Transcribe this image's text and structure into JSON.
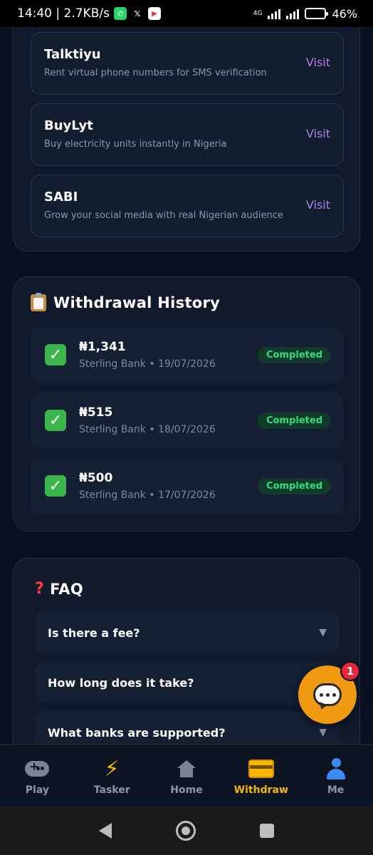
{
  "status_bar": {
    "time_speed": "14:40 | 2.7KB/s",
    "network": "4G",
    "battery": "46%",
    "battery_level": 0.46
  },
  "partners": [
    {
      "name": "Talktiyu",
      "desc": "Rent virtual phone numbers for SMS verification",
      "action": "Visit"
    },
    {
      "name": "BuyLyt",
      "desc": "Buy electricity units instantly in Nigeria",
      "action": "Visit"
    },
    {
      "name": "SABI",
      "desc": "Grow your social media with real Nigerian audience",
      "action": "Visit"
    }
  ],
  "history": {
    "title": "Withdrawal History",
    "items": [
      {
        "amount": "₦1,341",
        "meta": "Sterling Bank • 19/07/2026",
        "status": "Completed"
      },
      {
        "amount": "₦515",
        "meta": "Sterling Bank • 18/07/2026",
        "status": "Completed"
      },
      {
        "amount": "₦500",
        "meta": "Sterling Bank • 17/07/2026",
        "status": "Completed"
      }
    ]
  },
  "faq": {
    "title": "FAQ",
    "items": [
      {
        "q": "Is there a fee?"
      },
      {
        "q": "How long does it take?"
      },
      {
        "q": "What banks are supported?"
      }
    ]
  },
  "chat": {
    "badge": "1"
  },
  "nav": {
    "items": [
      {
        "label": "Play",
        "icon": "gamepad-icon"
      },
      {
        "label": "Tasker",
        "icon": "bolt-icon"
      },
      {
        "label": "Home",
        "icon": "home-icon"
      },
      {
        "label": "Withdraw",
        "icon": "credit-card-icon"
      },
      {
        "label": "Me",
        "icon": "user-icon"
      }
    ],
    "active": "Withdraw"
  },
  "colors": {
    "accent": "#f5b800",
    "visit": "#b57cf0",
    "completed": "#2ee07a",
    "background": "#0a1020"
  }
}
